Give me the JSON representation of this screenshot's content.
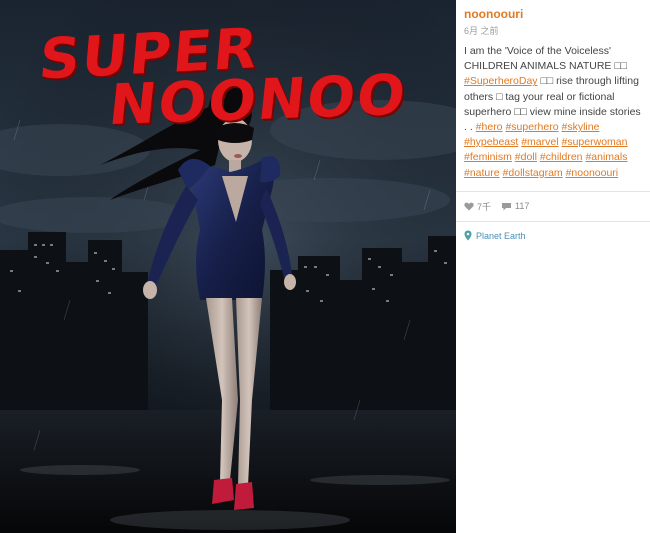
{
  "photo": {
    "title_line_1": "SUPER",
    "title_line_2": "NOONOO"
  },
  "post": {
    "username": "noonoouri",
    "timestamp": "6月 之前",
    "caption_segments": [
      {
        "text": "I am the 'Voice of the Voiceless' CHILDREN ANIMALS NATURE □□ ",
        "tag": false
      },
      {
        "text": "#SuperheroDay",
        "tag": true
      },
      {
        "text": " □□ rise through lifting others □ tag your real or fictional superhero □□ view mine inside stories . . ",
        "tag": false
      },
      {
        "text": "#hero",
        "tag": true
      },
      {
        "text": " ",
        "tag": false
      },
      {
        "text": "#superhero",
        "tag": true
      },
      {
        "text": " ",
        "tag": false
      },
      {
        "text": "#skyline",
        "tag": true
      },
      {
        "text": " ",
        "tag": false
      },
      {
        "text": "#hypebeast",
        "tag": true
      },
      {
        "text": " ",
        "tag": false
      },
      {
        "text": "#marvel",
        "tag": true
      },
      {
        "text": " ",
        "tag": false
      },
      {
        "text": "#superwoman",
        "tag": true
      },
      {
        "text": " ",
        "tag": false
      },
      {
        "text": "#feminism",
        "tag": true
      },
      {
        "text": " ",
        "tag": false
      },
      {
        "text": "#doll",
        "tag": true
      },
      {
        "text": " ",
        "tag": false
      },
      {
        "text": "#children",
        "tag": true
      },
      {
        "text": " ",
        "tag": false
      },
      {
        "text": "#animals",
        "tag": true
      },
      {
        "text": " ",
        "tag": false
      },
      {
        "text": "#nature",
        "tag": true
      },
      {
        "text": " ",
        "tag": false
      },
      {
        "text": "#dollstagram",
        "tag": true
      },
      {
        "text": " ",
        "tag": false
      },
      {
        "text": "#noonoouri",
        "tag": true
      }
    ],
    "likes": "7千",
    "comments": "117",
    "location": "Planet Earth"
  },
  "colors": {
    "accent": "#e07a23",
    "title_red": "#e0161b",
    "location_blue": "#4a8fb8",
    "muted": "#8a8a8a"
  },
  "icons": {
    "likes": "heart-icon",
    "comments": "comment-icon",
    "location": "map-pin-icon"
  }
}
